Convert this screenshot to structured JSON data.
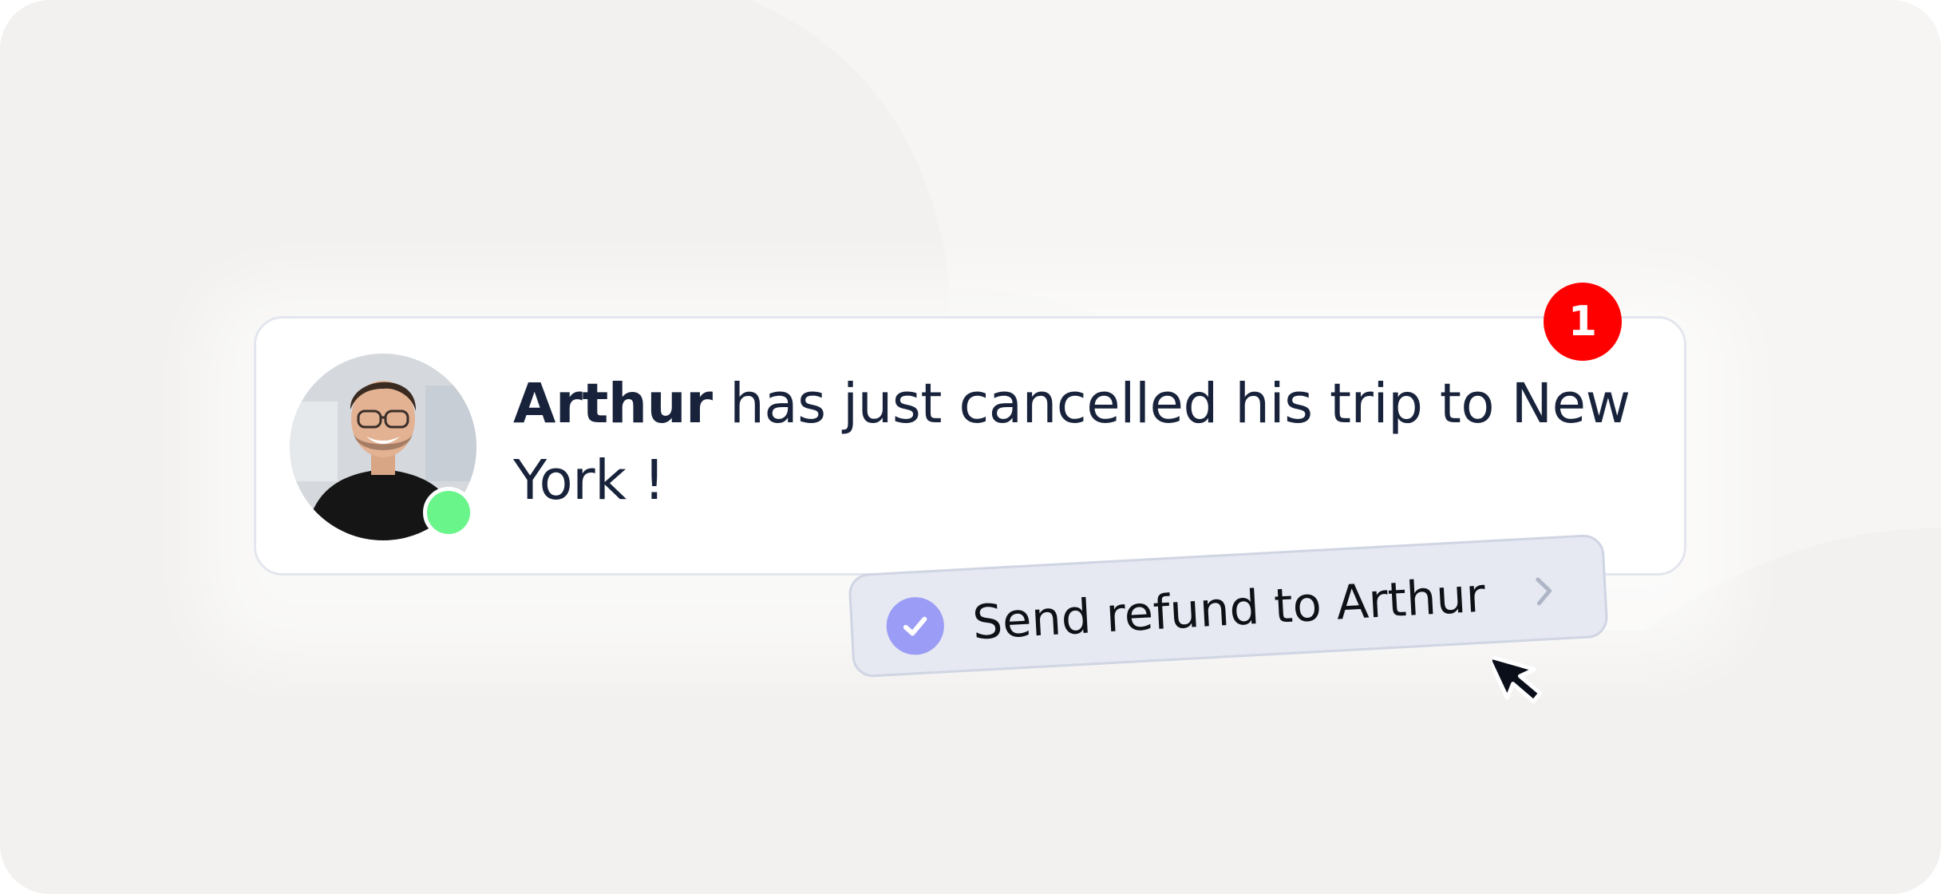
{
  "notification": {
    "name": "Arthur",
    "message_rest": " has just cancelled his trip to New York !",
    "unread_count": "1"
  },
  "action": {
    "label": "Send refund to Arthur"
  },
  "colors": {
    "badge": "#ff0000",
    "status_online": "#6af58b",
    "action_check": "#9a9cf5",
    "text_primary": "#18233b"
  },
  "icons": {
    "check": "check-circle-icon",
    "chevron": "chevron-right-icon",
    "cursor": "mouse-pointer-icon"
  }
}
